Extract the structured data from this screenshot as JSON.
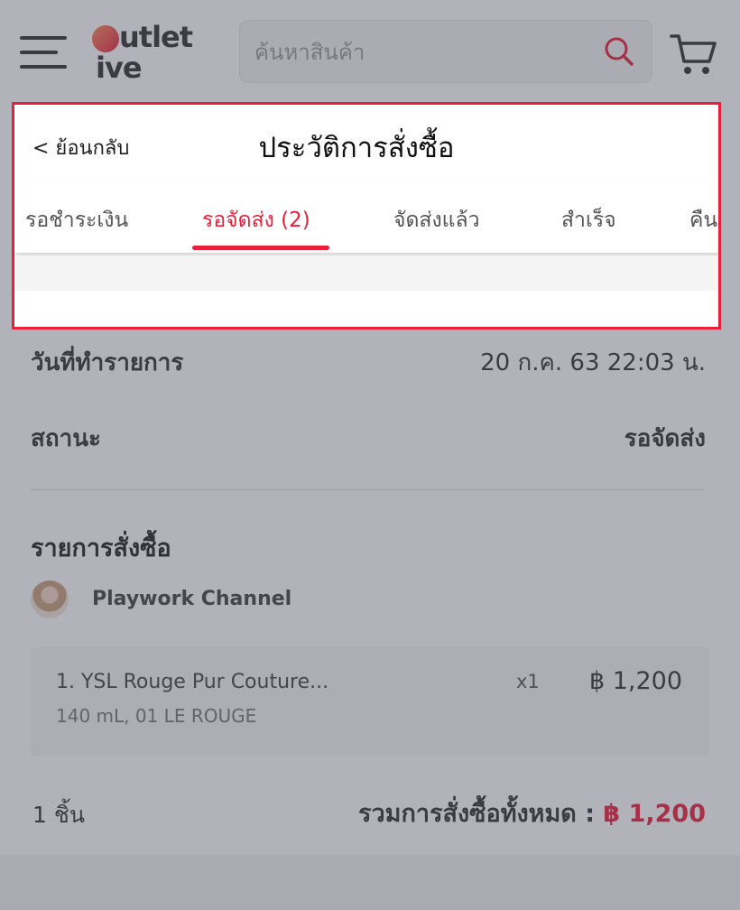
{
  "header": {
    "logo_top": "utlet",
    "logo_bottom": "ive",
    "search_placeholder": "ค้นหาสินค้า",
    "icons": [
      "hamburger-menu-icon",
      "search-icon",
      "cart-icon"
    ]
  },
  "page": {
    "back_label": "< ย้อนกลับ",
    "title": "ประวัติการสั่งซื้อ"
  },
  "tabs": [
    {
      "label": "รอชำระเงิน",
      "active": false
    },
    {
      "label": "รอจัดส่ง (2)",
      "active": true
    },
    {
      "label": "จัดส่งแล้ว",
      "active": false
    },
    {
      "label": "สำเร็จ",
      "active": false
    },
    {
      "label": "คืนเงิน",
      "active": false
    }
  ],
  "order": {
    "date_label": "วันที่ทำรายการ",
    "date_value": "20 ก.ค. 63  22:03 น.",
    "status_label": "สถานะ",
    "status_value": "รอจัดส่ง",
    "section_title": "รายการสั่งซื้อ",
    "shop_name": "Playwork Channel",
    "items": [
      {
        "name": "1. YSL Rouge Pur Couture...",
        "variant": "140 mL, 01 LE ROUGE",
        "qty": "x1",
        "price": "฿ 1,200"
      }
    ],
    "count": "1 ชิ้น",
    "total_label": "รวมการสั่งซื้อทั้งหมด : ",
    "total_amount": "฿ 1,200"
  },
  "colors": {
    "accent": "#e8203a",
    "highlight_border": "#e8203a"
  }
}
